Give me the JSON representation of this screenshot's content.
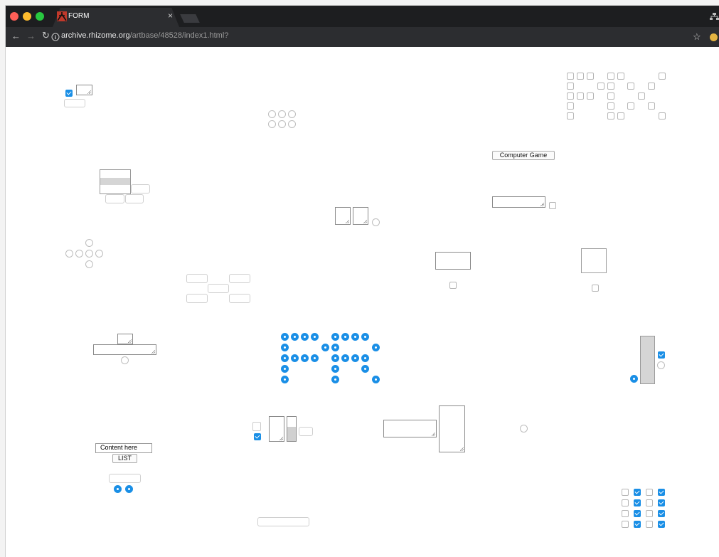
{
  "browser": {
    "tab_title": "FORM",
    "tab_close": "×",
    "url_host": "archive.rhizome.org",
    "url_path": "/artbase/48528/index1.html?",
    "colors": {
      "close": "#fe5f57",
      "minimize": "#febc2e",
      "maximize": "#28c840",
      "accent": "#1a8fe6"
    }
  },
  "page": {
    "game_button_label": "Computer Game",
    "content_input_value": "Content here",
    "list_button_label": "LIST"
  }
}
